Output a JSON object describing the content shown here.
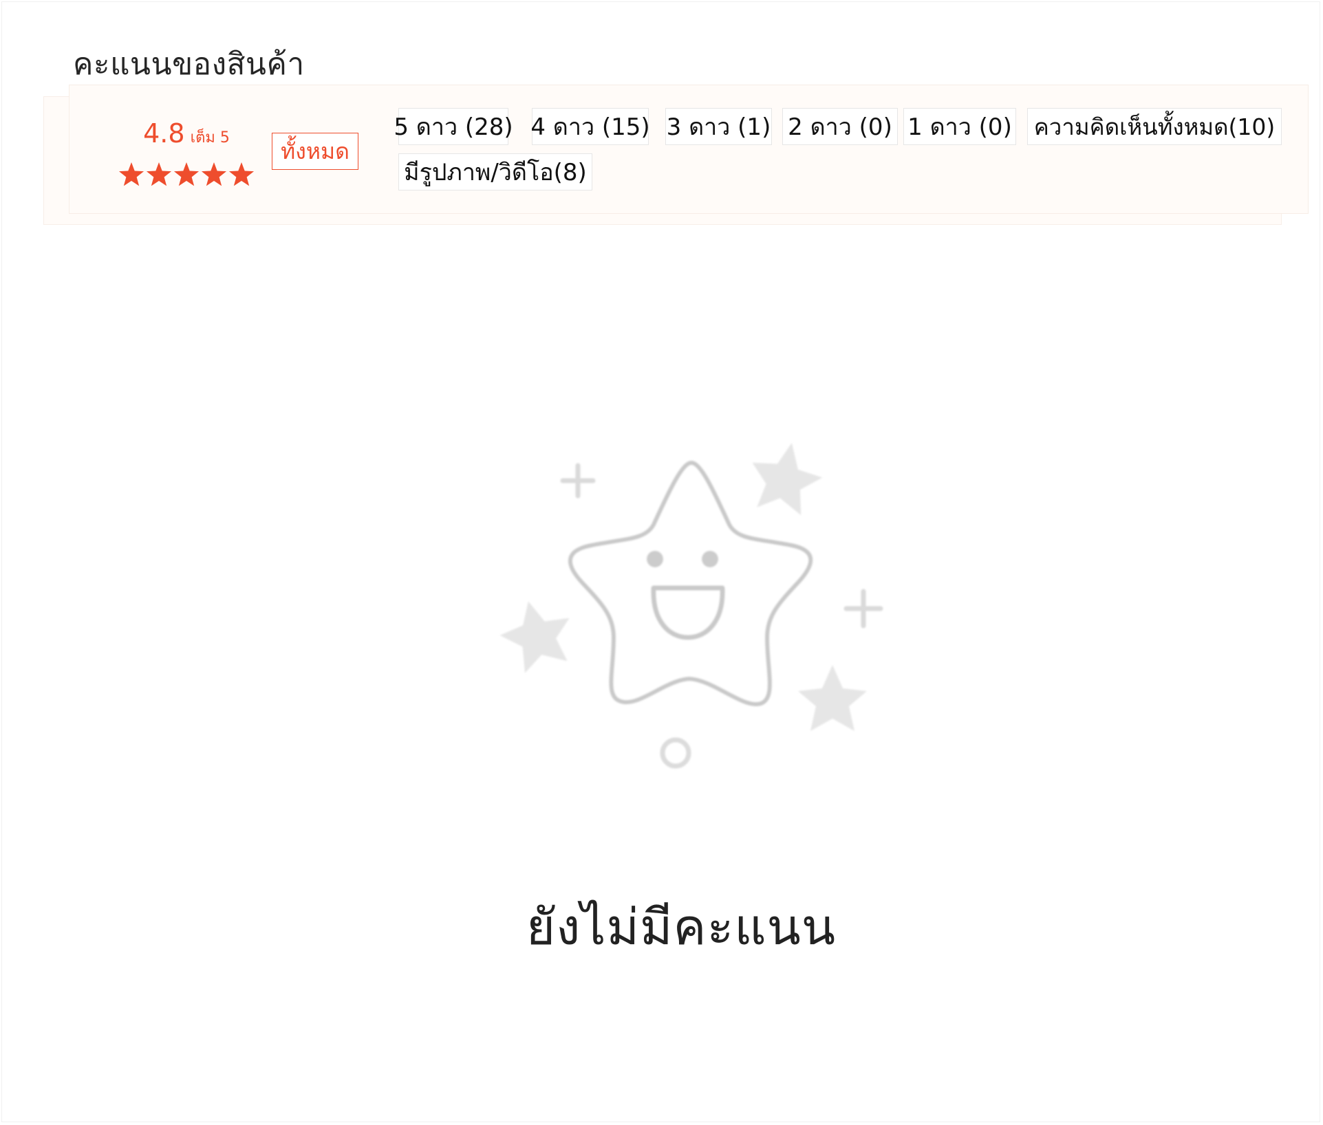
{
  "section": {
    "title": "คะแนนของสินค้า"
  },
  "rating": {
    "score": "4.8",
    "suffix": "เต็ม 5",
    "stars_filled": 5,
    "stars_total": 5,
    "star_color": "#ee4d2d"
  },
  "filters": {
    "all_label": "ทั้งหมด",
    "chips": [
      "5 ดาว (28)",
      "4 ดาว (15)",
      "3 ดาว (1)",
      "2 ดาว (0)",
      "1 ดาว (0)",
      "ความคิดเห็นทั้งหมด(10)",
      "มีรูปภาพ/วิดีโอ(8)"
    ]
  },
  "empty_state": {
    "message": "ยังไม่มีคะแนน",
    "icon": "smiling-star-icon"
  },
  "colors": {
    "accent": "#ee4d2d",
    "panel_background": "#fffbf8"
  }
}
